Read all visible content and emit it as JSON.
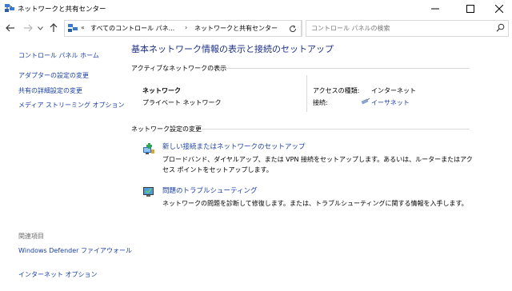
{
  "window": {
    "title": "ネットワークと共有センター",
    "minimize": "—",
    "maximize": "□",
    "close": "✕"
  },
  "address": {
    "overflow": "«",
    "segments": [
      "すべてのコントロール パネ...",
      "ネットワークと共有センター"
    ],
    "separator": "›"
  },
  "search": {
    "placeholder": "コントロール パネルの検索"
  },
  "sidebar": {
    "home": "コントロール パネル ホーム",
    "items": [
      "アダプターの設定の変更",
      "共有の詳細設定の変更",
      "メディア ストリーミング オプション"
    ],
    "related_header": "関連項目",
    "related": [
      "Windows Defender ファイアウォール",
      "インターネット オプション"
    ]
  },
  "main": {
    "title": "基本ネットワーク情報の表示と接続のセットアップ",
    "active_section": "アクティブなネットワークの表示",
    "network": {
      "name": "ネットワーク",
      "type": "プライベート ネットワーク",
      "access_label": "アクセスの種類:",
      "access_value": "インターネット",
      "conn_label": "接続:",
      "conn_value": "イーサネット"
    },
    "change_section": "ネットワーク設定の変更",
    "tasks": [
      {
        "title": "新しい接続またはネットワークのセットアップ",
        "desc": "ブロードバンド、ダイヤルアップ、または VPN 接続をセットアップします。あるいは、ルーターまたはアクセス ポイントをセットアップします。",
        "icon": "network-setup-icon"
      },
      {
        "title": "問題のトラブルシューティング",
        "desc": "ネットワークの問題を診断して修復します。または、トラブルシューティングに関する情報を入手します。",
        "icon": "troubleshoot-icon"
      }
    ]
  },
  "colors": {
    "link": "#1a3fa3",
    "title": "#1e3287",
    "divider": "#d9d9d9"
  }
}
